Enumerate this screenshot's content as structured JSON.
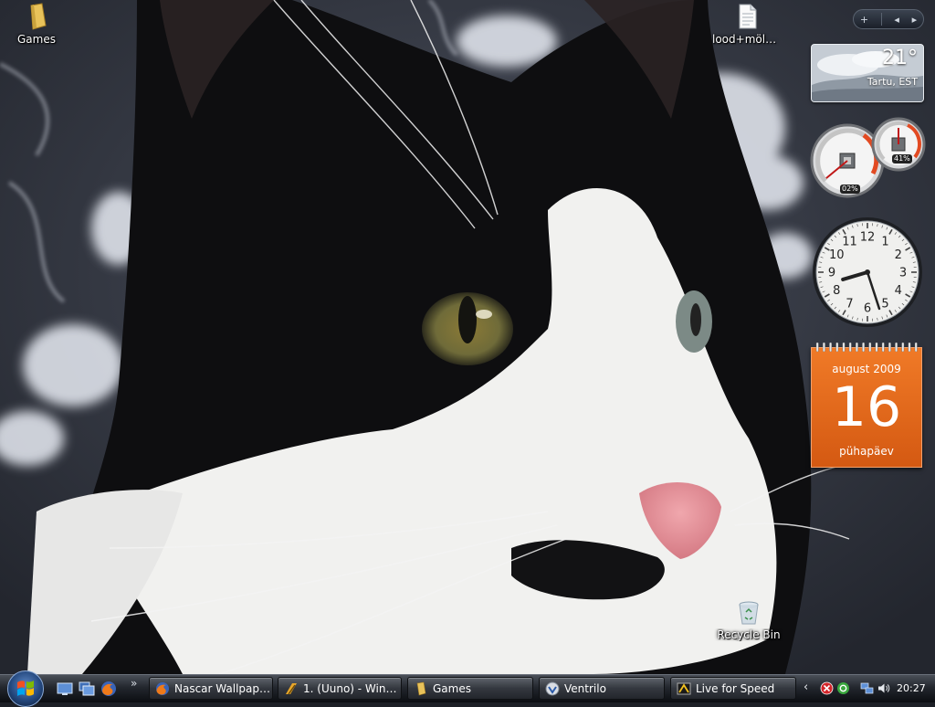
{
  "desktop": {
    "icons": [
      {
        "label": "Games",
        "icon": "folder-icon"
      },
      {
        "label": "lood+möla....",
        "icon": "text-file-icon"
      },
      {
        "label": "Recycle Bin",
        "icon": "recycle-bin-icon"
      }
    ]
  },
  "sidebar": {
    "controls": {
      "add": "+",
      "prev": "◂",
      "next": "▸"
    },
    "weather": {
      "temperature": "21°",
      "location": "Tartu, EST"
    },
    "cpu_meter": {
      "cpu_percent": "02%",
      "memory_percent": "41%",
      "cpu_level": 0.02,
      "memory_level": 0.41
    },
    "clock": {
      "hour": 20,
      "minute": 27,
      "numbers": [
        "12",
        "1",
        "2",
        "3",
        "4",
        "5",
        "6",
        "7",
        "8",
        "9",
        "10",
        "11"
      ]
    },
    "calendar": {
      "month": "august 2009",
      "day": "16",
      "weekday": "pühapäev"
    }
  },
  "taskbar": {
    "start": {
      "icon": "windows-logo-icon"
    },
    "quick_launch": [
      {
        "icon": "show-desktop-icon"
      },
      {
        "icon": "switch-windows-icon"
      },
      {
        "icon": "firefox-icon"
      }
    ],
    "quick_launch_more": "»",
    "tasks": [
      {
        "label": "Nascar Wallpape...",
        "icon": "firefox-icon"
      },
      {
        "label": "1.  (Uuno) - Wina...",
        "icon": "winamp-icon"
      },
      {
        "label": "Games",
        "icon": "folder-icon"
      },
      {
        "label": "Ventrilo",
        "icon": "ventrilo-icon"
      },
      {
        "label": "Live for Speed",
        "icon": "live-for-speed-icon"
      }
    ],
    "tray": {
      "expand": "‹",
      "icons": [
        "antivirus-icon",
        "messenger-icon",
        "network-icon",
        "volume-icon"
      ],
      "time": "20:27"
    }
  },
  "colors": {
    "calendar_orange": "#e4661a",
    "taskbar_dark": "#1b1e24",
    "fur_black": "#0d0d0f",
    "fur_white": "#f2f2f0"
  }
}
